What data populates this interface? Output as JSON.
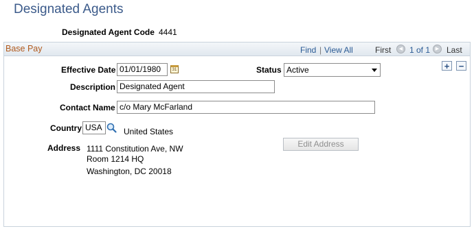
{
  "page": {
    "title": "Designated Agents"
  },
  "header": {
    "code_label": "Designated Agent Code",
    "code_value": "4441"
  },
  "panel": {
    "title": "Base Pay",
    "find_label": "Find",
    "separator": "|",
    "view_all_label": "View All",
    "first_label": "First",
    "range_label": "1 of 1",
    "last_label": "Last",
    "add_row_symbol": "+",
    "delete_row_symbol": "−"
  },
  "form": {
    "effective_date": {
      "label": "Effective Date",
      "value": "01/01/1980"
    },
    "status": {
      "label": "Status",
      "value": "Active"
    },
    "description": {
      "label": "Description",
      "value": "Designated Agent"
    },
    "contact_name": {
      "label": "Contact Name",
      "value": "c/o Mary McFarland"
    },
    "country": {
      "label": "Country",
      "value": "USA",
      "description": "United States"
    },
    "address": {
      "label": "Address",
      "lines": [
        "1111 Constitution Ave, NW",
        "Room 1214 HQ",
        "Washington, DC 20018"
      ],
      "edit_button_label": "Edit Address"
    }
  },
  "icons": {
    "calendar": "calendar-icon",
    "lookup": "magnifying-glass-icon",
    "prev": "arrow-left-icon",
    "next": "arrow-right-icon"
  },
  "colors": {
    "title": "#3b5a8a",
    "panel_title": "#b05a1e",
    "link": "#2a5a94",
    "panel_border": "#c9d3dc"
  }
}
